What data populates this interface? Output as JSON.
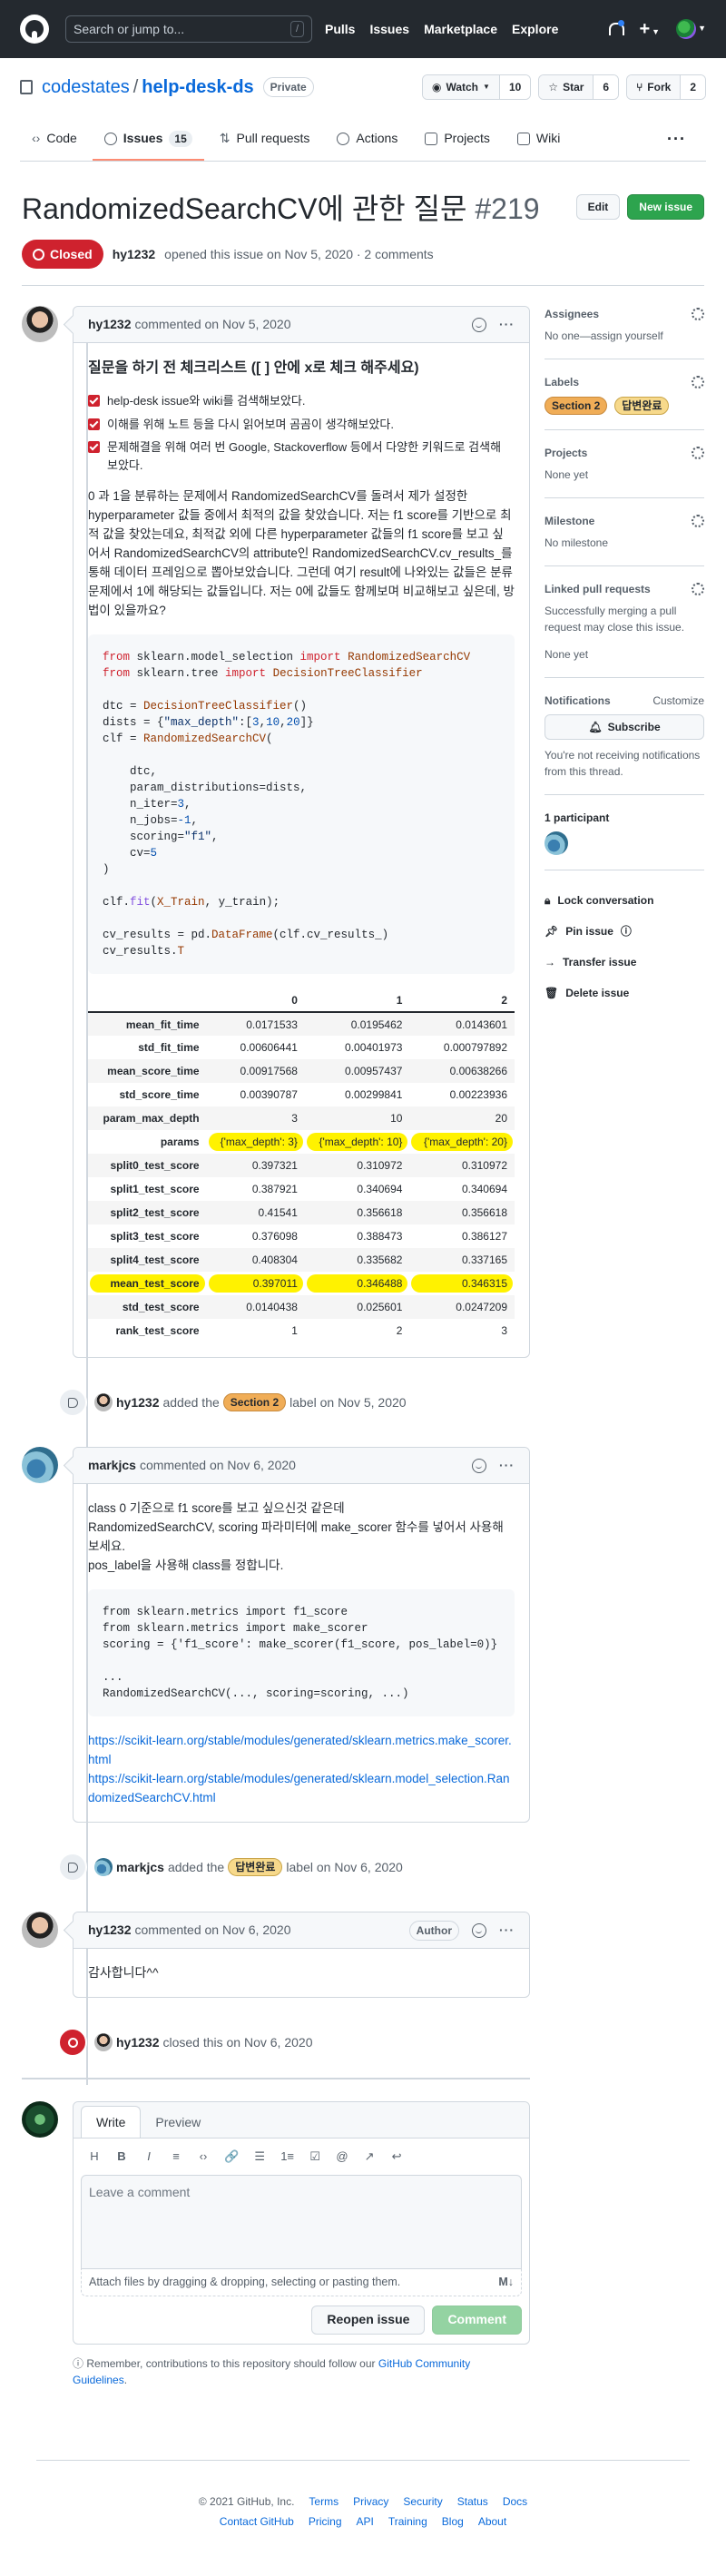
{
  "header": {
    "search_placeholder": "Search or jump to...",
    "search_key": "/",
    "nav": [
      "Pulls",
      "Issues",
      "Marketplace",
      "Explore"
    ]
  },
  "repo": {
    "owner": "codestates",
    "name": "help-desk-ds",
    "visibility": "Private",
    "watch_label": "Watch",
    "watch_count": "10",
    "star_label": "Star",
    "star_count": "6",
    "fork_label": "Fork",
    "fork_count": "2"
  },
  "tabs": [
    {
      "label": "Code"
    },
    {
      "label": "Issues",
      "count": "15"
    },
    {
      "label": "Pull requests"
    },
    {
      "label": "Actions"
    },
    {
      "label": "Projects"
    },
    {
      "label": "Wiki"
    }
  ],
  "issue": {
    "title": "RandomizedSearchCV에 관한 질문",
    "number": "#219",
    "edit_label": "Edit",
    "new_label": "New issue",
    "state": "Closed",
    "author": "hy1232",
    "opened_text": "opened this issue on Nov 5, 2020 · 2 comments"
  },
  "comment1": {
    "author": "hy1232",
    "meta": "commented on Nov 5, 2020",
    "heading": "질문을 하기 전 체크리스트 ([ ] 안에 x로 체크 해주세요)",
    "checks": [
      "help-desk issue와 wiki를 검색해보았다.",
      "이해를 위해 노트 등을 다시 읽어보며 곰곰이 생각해보았다.",
      "문제해결을 위해 여러 번 Google, Stackoverflow 등에서 다양한 키워드로 검색해 보았다."
    ],
    "body": "0 과 1을 분류하는 문제에서 RandomizedSearchCV를 돌려서 제가 설정한 hyperparameter 값들 중에서 최적의 값을 찾았습니다. 저는 f1 score를 기반으로 최적 값을 찾았는데요, 최적값 외에 다른 hyperparameter 값들의 f1 score를 보고 싶어서 RandomizedSearchCV의 attribute인 RandomizedSearchCV.cv_results_를 통해 데이터 프레임으로 뽑아보았습니다. 그런데 여기 result에 나와있는 값들은 분류문제에서 1에 해당되는 값들입니다. 저는 0에 값들도 함께보며 비교해보고 싶은데, 방법이 있을까요?"
  },
  "dataframe": {
    "columns": [
      "0",
      "1",
      "2"
    ],
    "rows": [
      {
        "name": "mean_fit_time",
        "v": [
          "0.0171533",
          "0.0195462",
          "0.0143601"
        ]
      },
      {
        "name": "std_fit_time",
        "v": [
          "0.00606441",
          "0.00401973",
          "0.000797892"
        ]
      },
      {
        "name": "mean_score_time",
        "v": [
          "0.00917568",
          "0.00957437",
          "0.00638266"
        ]
      },
      {
        "name": "std_score_time",
        "v": [
          "0.00390787",
          "0.00299841",
          "0.00223936"
        ]
      },
      {
        "name": "param_max_depth",
        "v": [
          "3",
          "10",
          "20"
        ]
      },
      {
        "name": "params",
        "v": [
          "{'max_depth': 3}",
          "{'max_depth': 10}",
          "{'max_depth': 20}"
        ]
      },
      {
        "name": "split0_test_score",
        "v": [
          "0.397321",
          "0.310972",
          "0.310972"
        ]
      },
      {
        "name": "split1_test_score",
        "v": [
          "0.387921",
          "0.340694",
          "0.340694"
        ]
      },
      {
        "name": "split2_test_score",
        "v": [
          "0.41541",
          "0.356618",
          "0.356618"
        ]
      },
      {
        "name": "split3_test_score",
        "v": [
          "0.376098",
          "0.388473",
          "0.386127"
        ]
      },
      {
        "name": "split4_test_score",
        "v": [
          "0.408304",
          "0.335682",
          "0.337165"
        ]
      },
      {
        "name": "mean_test_score",
        "v": [
          "0.397011",
          "0.346488",
          "0.346315"
        ]
      },
      {
        "name": "std_test_score",
        "v": [
          "0.0140438",
          "0.025601",
          "0.0247209"
        ]
      },
      {
        "name": "rank_test_score",
        "v": [
          "1",
          "2",
          "3"
        ]
      }
    ]
  },
  "event1": {
    "actor": "hy1232",
    "pre": "added the",
    "label": "Section 2",
    "post": "label on Nov 5, 2020"
  },
  "comment2": {
    "author": "markjcs",
    "meta": "commented on Nov 6, 2020",
    "line1": "class 0 기준으로 f1 score를 보고 싶으신것 같은데",
    "line2": "RandomizedSearchCV, scoring 파라미터에 make_scorer 함수를 넣어서 사용해 보세요.",
    "line3": "pos_label을 사용해 class를 정합니다.",
    "code": [
      "from sklearn.metrics import f1_score",
      "from sklearn.metrics import make_scorer",
      "scoring = {'f1_score': make_scorer(f1_score, pos_label=0)}",
      "",
      "...",
      "RandomizedSearchCV(..., scoring=scoring, ...)"
    ],
    "link1": "https://scikit-learn.org/stable/modules/generated/sklearn.metrics.make_scorer.html",
    "link2": "https://scikit-learn.org/stable/modules/generated/sklearn.model_selection.RandomizedSearchCV.html"
  },
  "event2": {
    "actor": "markjcs",
    "pre": "added the",
    "label": "답변완료",
    "post": "label on Nov 6, 2020"
  },
  "comment3": {
    "author": "hy1232",
    "meta": "commented on Nov 6, 2020",
    "badge": "Author",
    "body": "감사합니다^^"
  },
  "event3": {
    "actor": "hy1232",
    "text": "closed this on Nov 6, 2020"
  },
  "editor": {
    "write": "Write",
    "preview": "Preview",
    "placeholder": "Leave a comment",
    "attach": "Attach files by dragging & dropping, selecting or pasting them.",
    "reopen": "Reopen issue",
    "comment": "Comment",
    "toolbar": [
      "H",
      "B",
      "I",
      "≡",
      "‹›",
      "🔗",
      "☰",
      "1≡",
      "☑",
      "@",
      "↗",
      "↩"
    ],
    "remember_pre": "Remember, contributions to this repository should follow our",
    "remember_link": "GitHub Community Guidelines",
    "remember_post": "."
  },
  "sidebar": {
    "assignees_h": "Assignees",
    "assignees_v": "No one—assign yourself",
    "labels_h": "Labels",
    "labels": [
      "Section 2",
      "답변완료"
    ],
    "projects_h": "Projects",
    "projects_v": "None yet",
    "milestone_h": "Milestone",
    "milestone_v": "No milestone",
    "linked_h": "Linked pull requests",
    "linked_desc": "Successfully merging a pull request may close this issue.",
    "linked_v": "None yet",
    "notif_h": "Notifications",
    "customize": "Customize",
    "subscribe": "Subscribe",
    "notif_desc": "You're not receiving notifications from this thread.",
    "participants": "1 participant",
    "lock": "Lock conversation",
    "pin": "Pin issue",
    "transfer": "Transfer issue",
    "delete": "Delete issue"
  },
  "footer": {
    "copy": "© 2021 GitHub, Inc.",
    "row1": [
      "Terms",
      "Privacy",
      "Security",
      "Status",
      "Docs"
    ],
    "row2": [
      "Contact GitHub",
      "Pricing",
      "API",
      "Training",
      "Blog",
      "About"
    ]
  },
  "colors": {
    "header_bg": "#24292f",
    "closed": "#cf222e",
    "green": "#2da44e",
    "link": "#0969da",
    "highlight": "#fff200"
  }
}
